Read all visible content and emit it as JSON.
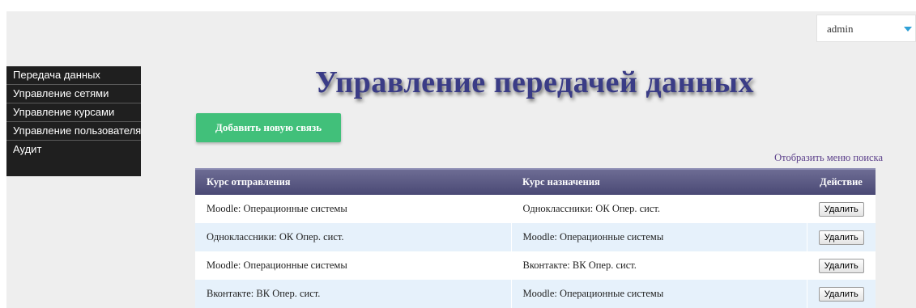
{
  "header": {
    "user_select": {
      "value": "admin"
    }
  },
  "sidebar": {
    "items": [
      {
        "label": "Передача данных"
      },
      {
        "label": "Управление сетями"
      },
      {
        "label": "Управление курсами"
      },
      {
        "label": "Управление пользователями"
      },
      {
        "label": "Аудит"
      }
    ]
  },
  "main": {
    "title": "Управление передачей данных",
    "add_button_label": "Добавить новую связь",
    "search_menu_link": "Отобразить меню поиска",
    "table": {
      "columns": [
        "Курс отправления",
        "Курс назначения",
        "Действие"
      ],
      "rows": [
        {
          "source": "Moodle: Операционные системы",
          "destination": "Одноклассники: ОК Опер. сист.",
          "action": "Удалить"
        },
        {
          "source": "Одноклассники: ОК Опер. сист.",
          "destination": "Moodle: Операционные системы",
          "action": "Удалить"
        },
        {
          "source": "Moodle: Операционные системы",
          "destination": "Вконтакте: ВК Опер. сист.",
          "action": "Удалить"
        },
        {
          "source": "Вконтакте: ВК Опер. сист.",
          "destination": "Moodle: Операционные системы",
          "action": "Удалить"
        }
      ]
    }
  },
  "colors": {
    "sidebar_bg": "#1f1f1f",
    "title": "#3a3c86",
    "add_button": "#41c07a",
    "table_header": "#5b5a85",
    "row_alt": "#e6f1fb",
    "link": "#5b3f8a",
    "select_arrow": "#2fa0d6"
  },
  "icons": {
    "select_arrow": "chevron-down-icon"
  }
}
